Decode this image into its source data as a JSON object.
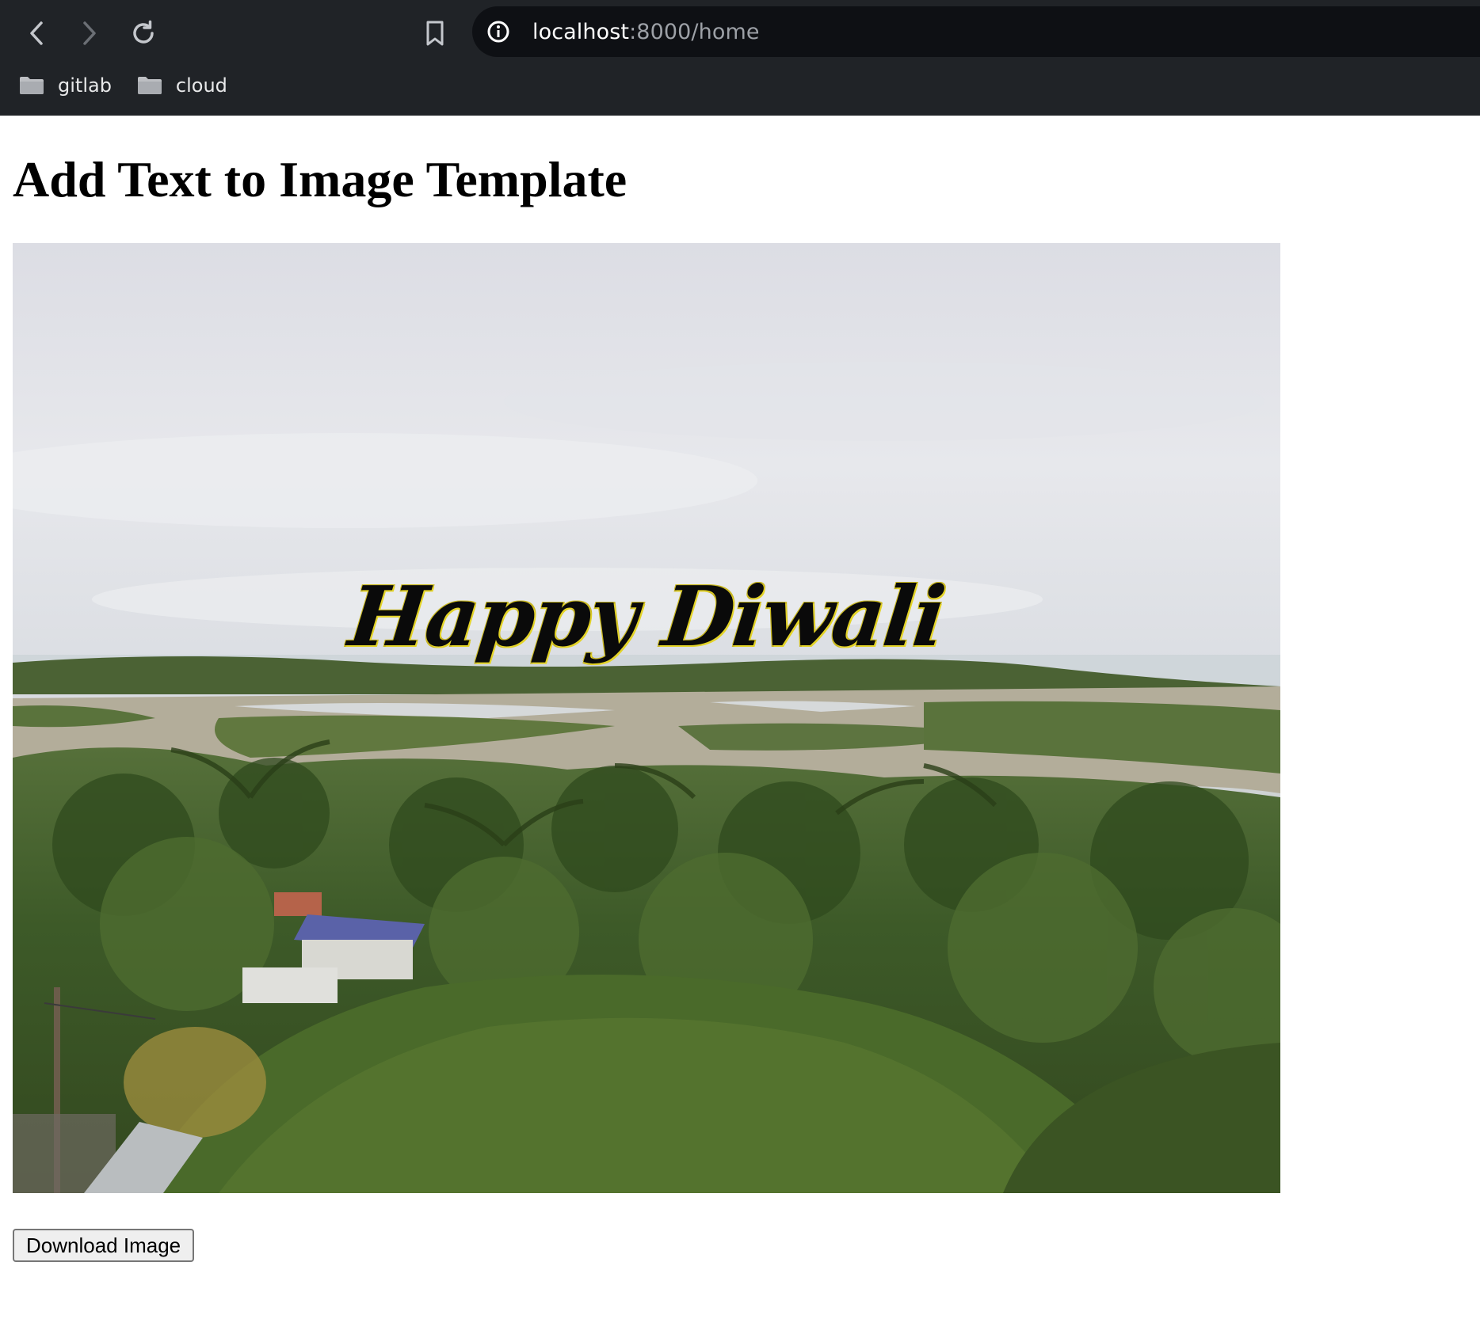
{
  "browser": {
    "url_host": "localhost",
    "url_path": ":8000/home",
    "bookmarks": [
      {
        "label": "gitlab",
        "icon": "folder-icon"
      },
      {
        "label": "cloud",
        "icon": "folder-icon"
      }
    ],
    "icons": {
      "back": "chevron-left-icon",
      "forward": "chevron-right-icon",
      "reload": "reload-icon",
      "bookmark": "bookmark-icon",
      "site_info": "info-icon"
    }
  },
  "page": {
    "title": "Add Text to Image Template",
    "template": {
      "overlay_text": "Happy Diwali",
      "overlay_text_color": "#0a0a0a",
      "overlay_outline_color": "#e3d327"
    },
    "download_label": "Download Image"
  },
  "colors": {
    "toolbar_bg": "#202327",
    "address_bar_bg": "#0e1014",
    "page_bg": "#ffffff"
  }
}
